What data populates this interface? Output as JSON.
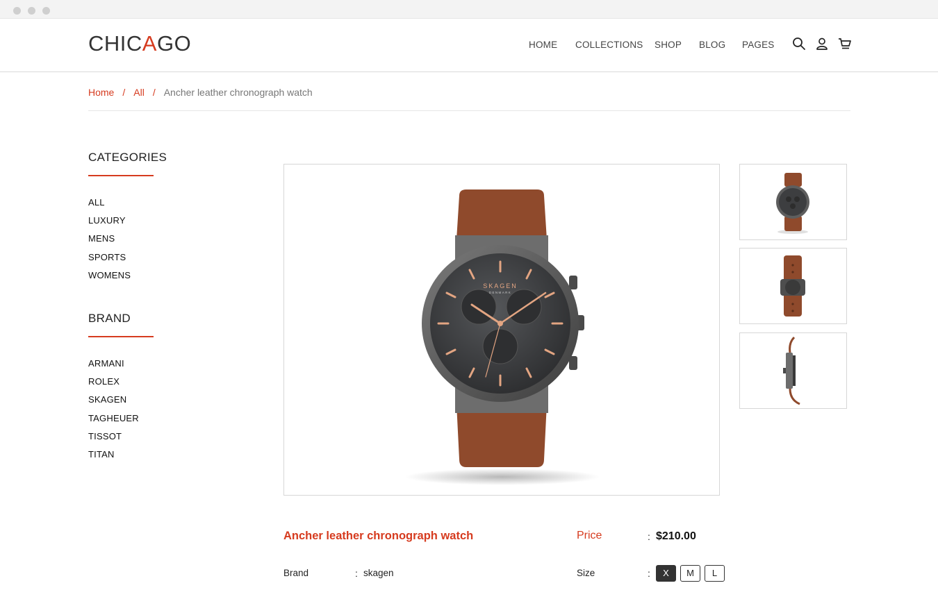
{
  "brand": {
    "logo_pre": "CHIC",
    "logo_accent": "A",
    "logo_post": "GO",
    "accent_color": "#d63b1f"
  },
  "nav": {
    "items": [
      "HOME",
      "COLLECTIONS",
      "SHOP",
      "BLOG",
      "PAGES"
    ],
    "icons": [
      "search-icon",
      "user-icon",
      "cart-icon"
    ]
  },
  "breadcrumb": {
    "home": "Home",
    "all": "All",
    "current": "Ancher leather chronograph watch",
    "separator": "/"
  },
  "sidebar": {
    "categories_heading": "CATEGORIES",
    "categories": [
      "ALL",
      "LUXURY",
      "MENS",
      "SPORTS",
      "WOMENS"
    ],
    "brand_heading": "BRAND",
    "brands": [
      "ARMANI",
      "ROLEX",
      "SKAGEN",
      "TAGHEUER",
      "TISSOT",
      "TITAN"
    ]
  },
  "product": {
    "title": "Ancher leather chronograph watch",
    "price_label": "Price",
    "price": "$210.00",
    "brand_label": "Brand",
    "brand_value": "skagen",
    "size_label": "Size",
    "sizes": [
      "X",
      "M",
      "L"
    ],
    "selected_size": "X",
    "dial_brand": "SKAGEN",
    "dial_sub": "DENMARK",
    "colors": {
      "strap": "#8f4a2c",
      "case": "#5a5a5a",
      "dial": "#3d3e40",
      "hands": "#e3a582"
    }
  }
}
